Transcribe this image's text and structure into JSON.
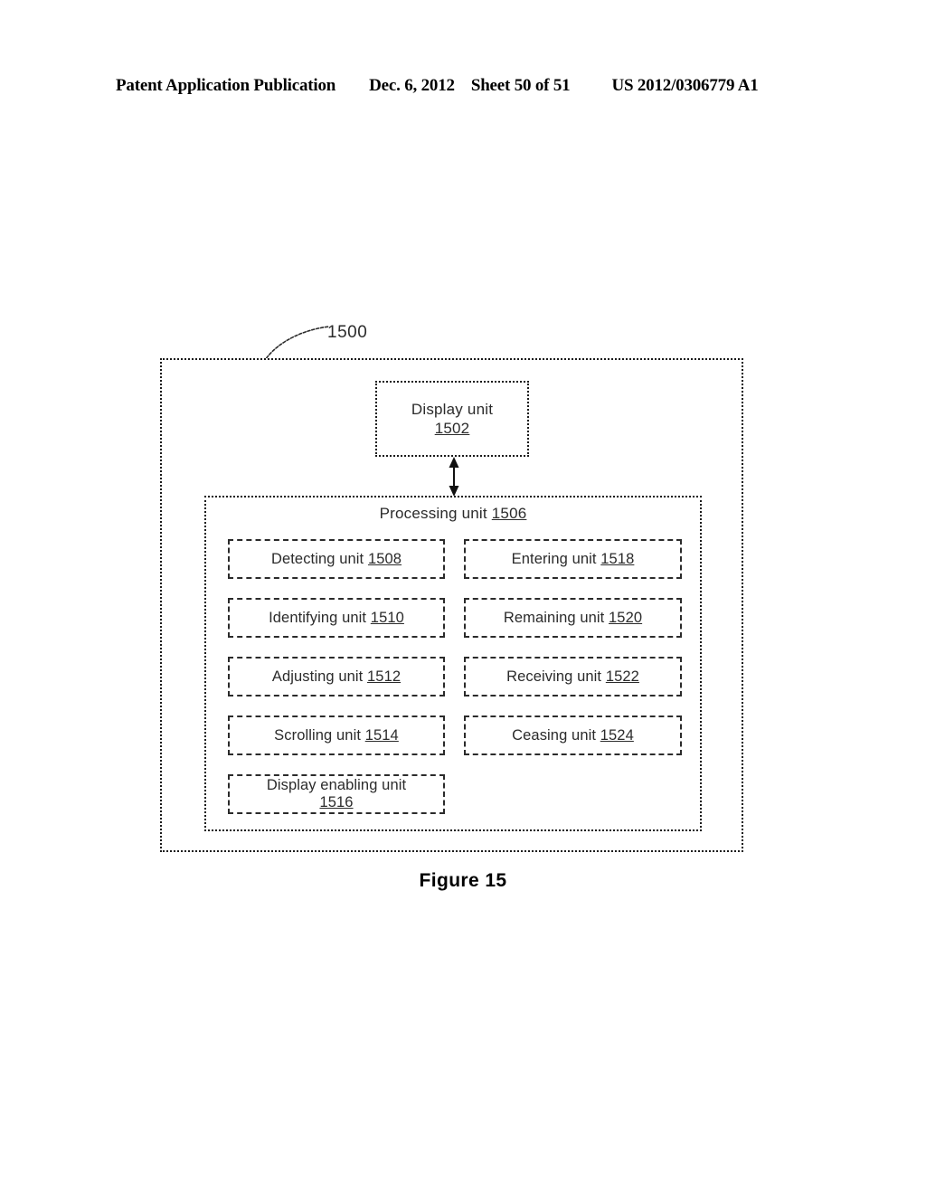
{
  "header": {
    "publication": "Patent Application Publication",
    "date": "Dec. 6, 2012",
    "sheet": "Sheet 50 of 51",
    "patent_number": "US 2012/0306779 A1"
  },
  "figure": {
    "caption": "Figure 15",
    "system_ref": "1500",
    "display_unit": {
      "label": "Display unit",
      "ref": "1502"
    },
    "processing_unit": {
      "label": "Processing unit",
      "ref": "1506"
    },
    "left_units": [
      {
        "label": "Detecting unit",
        "ref": "1508",
        "two_line": false
      },
      {
        "label": "Identifying unit",
        "ref": "1510",
        "two_line": false
      },
      {
        "label": "Adjusting unit",
        "ref": "1512",
        "two_line": false
      },
      {
        "label": "Scrolling unit",
        "ref": "1514",
        "two_line": false
      },
      {
        "label": "Display enabling unit",
        "ref": "1516",
        "two_line": true
      }
    ],
    "right_units": [
      {
        "label": "Entering unit",
        "ref": "1518",
        "two_line": false
      },
      {
        "label": "Remaining unit",
        "ref": "1520",
        "two_line": false
      },
      {
        "label": "Receiving unit",
        "ref": "1522",
        "two_line": false
      },
      {
        "label": "Ceasing unit",
        "ref": "1524",
        "two_line": false
      }
    ],
    "connector": "double-headed-vertical-arrow"
  },
  "colors": {
    "ink": "#1a1a1a",
    "text": "#2b2b2b",
    "paper": "#ffffff"
  }
}
